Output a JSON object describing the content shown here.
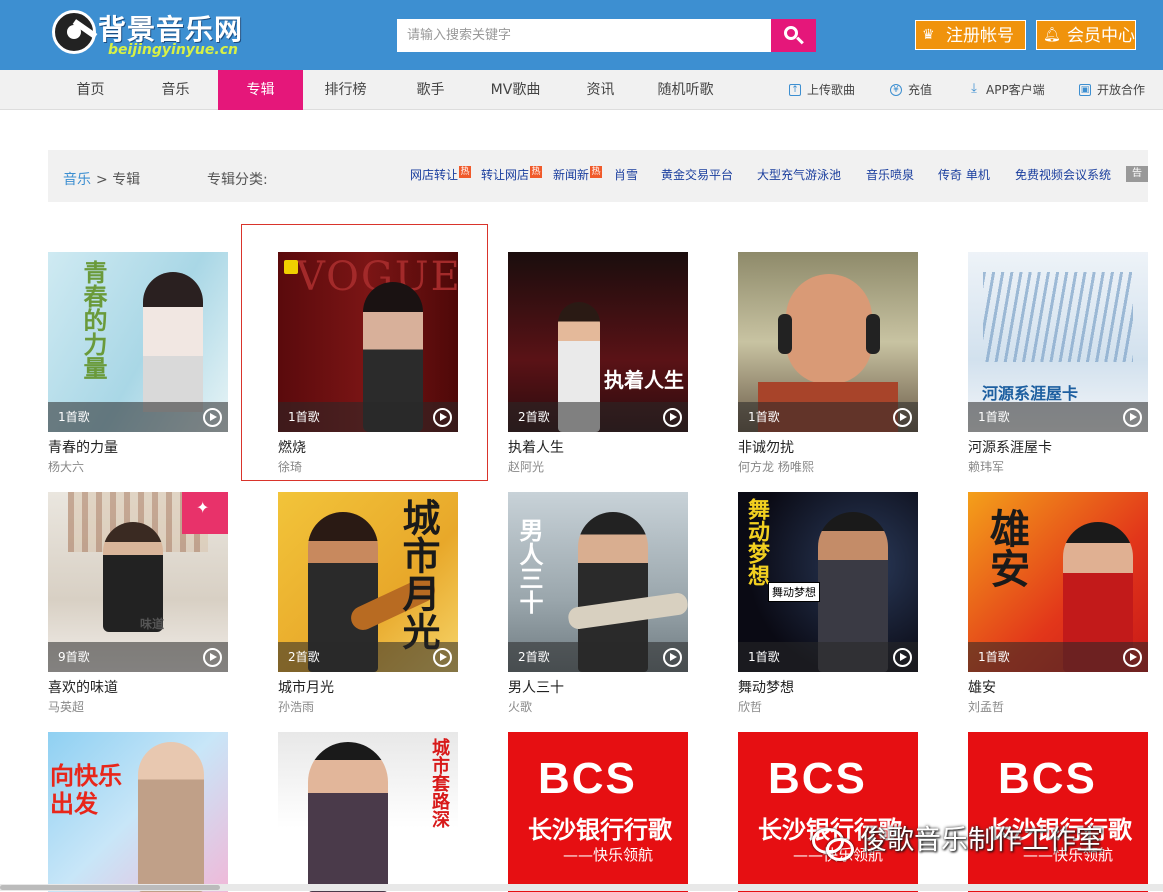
{
  "header": {
    "logo_cn": "背景音乐网",
    "logo_en": "beijingyinyue.cn",
    "search_placeholder": "请输入搜索关键字",
    "register_label": "注册帐号",
    "member_label": "会员中心",
    "colors": {
      "header_bg": "#3d8fd1",
      "accent": "#e5177a",
      "orange": "#f0930c"
    }
  },
  "nav": {
    "items": [
      "首页",
      "音乐",
      "专辑",
      "排行榜",
      "歌手",
      "MV歌曲",
      "资讯",
      "随机听歌"
    ],
    "active": "专辑",
    "right": [
      {
        "label": "上传歌曲",
        "icon": "upload-icon"
      },
      {
        "label": "充值",
        "icon": "yen-icon"
      },
      {
        "label": "APP客户端",
        "icon": "download-icon"
      },
      {
        "label": "开放合作",
        "icon": "briefcase-icon"
      }
    ]
  },
  "breadcrumb": {
    "root": "音乐",
    "sep": ">",
    "current": "专辑",
    "category_label": "专辑分类:",
    "tags": [
      "网店转让",
      "转让网店",
      "新闻新",
      "肖雪",
      "黄金交易平台",
      "大型充气游泳池",
      "音乐喷泉",
      "传奇 单机",
      "免费视频会议系统"
    ],
    "hot_badge": "热",
    "ad_label": "告"
  },
  "albums": [
    {
      "title": "青春的力量",
      "singer": "杨大六",
      "count": "1首歌",
      "cover_text": "青春的力量"
    },
    {
      "title": "燃烧",
      "singer": "徐琦",
      "count": "1首歌",
      "cover_text": "VOGUE"
    },
    {
      "title": "执着人生",
      "singer": "赵阿光",
      "count": "2首歌",
      "cover_text": "执着人生"
    },
    {
      "title": "非诚勿扰",
      "singer": "何方龙 杨唯熙",
      "count": "1首歌",
      "cover_text": ""
    },
    {
      "title": "河源系涯屋卡",
      "singer": "赖玮军",
      "count": "1首歌",
      "cover_text": "河源系涯屋卡"
    },
    {
      "title": "喜欢的味道",
      "singer": "马英超",
      "count": "9首歌",
      "cover_text": "味道"
    },
    {
      "title": "城市月光",
      "singer": "孙浩雨",
      "count": "2首歌",
      "cover_text": "城市月光"
    },
    {
      "title": "男人三十",
      "singer": "火歌",
      "count": "2首歌",
      "cover_text": "男人三十"
    },
    {
      "title": "舞动梦想",
      "singer": "欣哲",
      "count": "1首歌",
      "cover_text": "舞动梦想"
    },
    {
      "title": "雄安",
      "singer": "刘孟哲",
      "count": "1首歌",
      "cover_text": "雄安"
    },
    {
      "title": "",
      "singer": "",
      "count": "",
      "cover_text": "向快乐出发"
    },
    {
      "title": "",
      "singer": "",
      "count": "",
      "cover_text": "城市套路深"
    },
    {
      "title": "",
      "singer": "",
      "count": "",
      "cover_text": "长沙银行行歌"
    },
    {
      "title": "",
      "singer": "",
      "count": "",
      "cover_text": "长沙银行行歌"
    },
    {
      "title": "",
      "singer": "",
      "count": "",
      "cover_text": "长沙银行行歌"
    }
  ],
  "bcs": {
    "logo": "BCS",
    "line1": "长沙银行行歌",
    "line2": "——快乐领航"
  },
  "watermark": "俊歌音乐制作工作室"
}
